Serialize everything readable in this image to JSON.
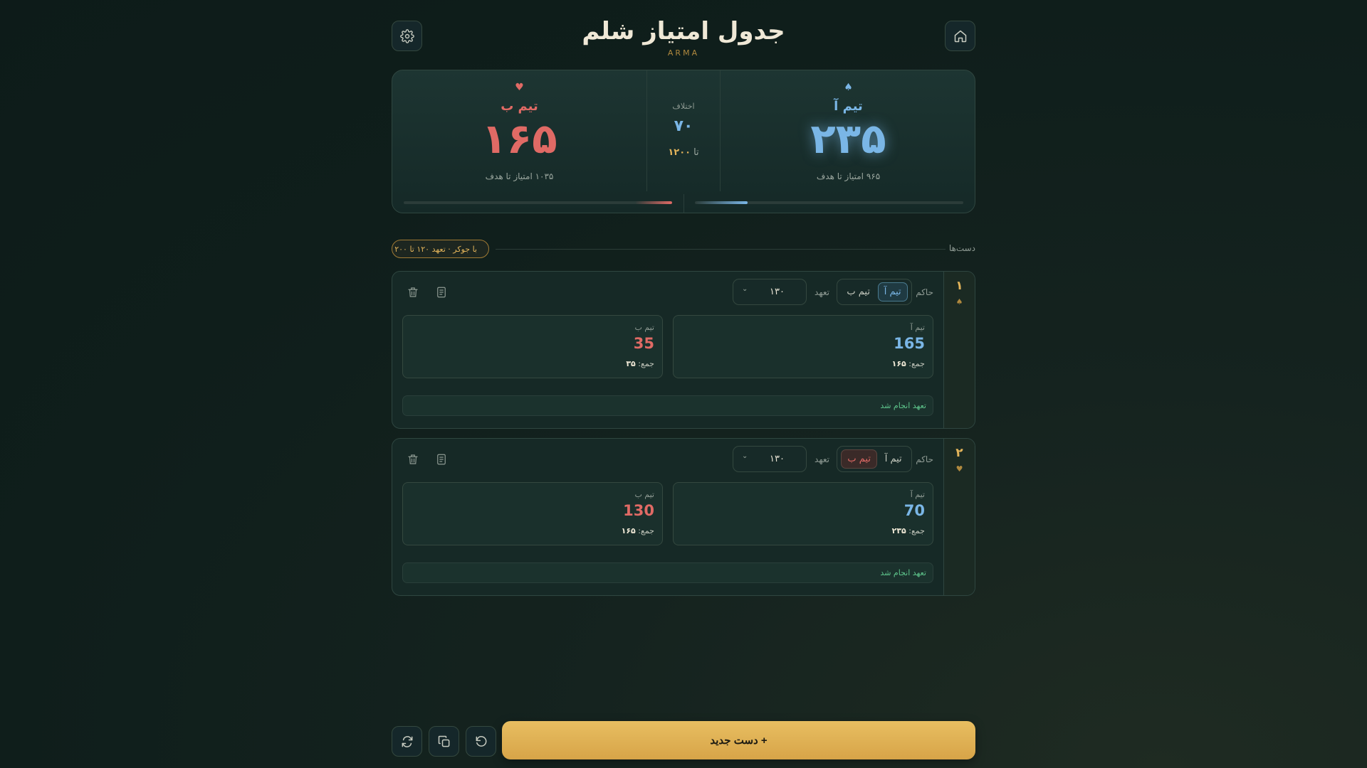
{
  "header": {
    "title": "جدول امتیاز شلم",
    "subtitle": "ARMA"
  },
  "scoreboard": {
    "team_a": {
      "suit": "♠",
      "name": "تیم آ",
      "score": "۲۳۵",
      "to_target": "۹۶۵ امتیاز تا هدف",
      "progress": 0.196,
      "color": "#7ab6e6"
    },
    "team_b": {
      "suit": "♥",
      "name": "تیم ب",
      "score": "۱۶۵",
      "to_target": "۱۰۳۵ امتیاز تا هدف",
      "progress": 0.138,
      "color": "#e06a65"
    },
    "middle": {
      "label": "اختلاف",
      "diff": "۷۰",
      "target_prefix": "تا",
      "target": "۱۲۰۰"
    }
  },
  "section": {
    "title": "دست‌ها",
    "badge": "با جوکر · تعهد ۱۲۰ تا ۲۰۰"
  },
  "hands": [
    {
      "number": "۱",
      "suit": "♠",
      "ruler_label": "حاکم",
      "opt_a": "تیم آ",
      "opt_b": "تیم ب",
      "ruler": "a",
      "bid_label": "تعهد",
      "bid": "۱۳۰",
      "a": {
        "label": "تیم آ",
        "value": "165",
        "total_label": "جمع:",
        "total": "۱۶۵"
      },
      "b": {
        "label": "تیم ب",
        "value": "35",
        "total_label": "جمع:",
        "total": "۳۵"
      },
      "status": "تعهد انجام شد"
    },
    {
      "number": "۲",
      "suit": "♥",
      "ruler_label": "حاکم",
      "opt_a": "تیم آ",
      "opt_b": "تیم ب",
      "ruler": "b",
      "bid_label": "تعهد",
      "bid": "۱۳۰",
      "a": {
        "label": "تیم آ",
        "value": "70",
        "total_label": "جمع:",
        "total": "۲۳۵"
      },
      "b": {
        "label": "تیم ب",
        "value": "130",
        "total_label": "جمع:",
        "total": "۱۶۵"
      },
      "status": "تعهد انجام شد"
    }
  ],
  "footer": {
    "new_hand": "+ دست جدید"
  },
  "icons": {
    "home": "home-icon",
    "settings": "gear-icon",
    "note": "note-icon",
    "trash": "trash-icon",
    "undo": "undo-icon",
    "copy": "copy-icon",
    "reset": "refresh-icon"
  }
}
